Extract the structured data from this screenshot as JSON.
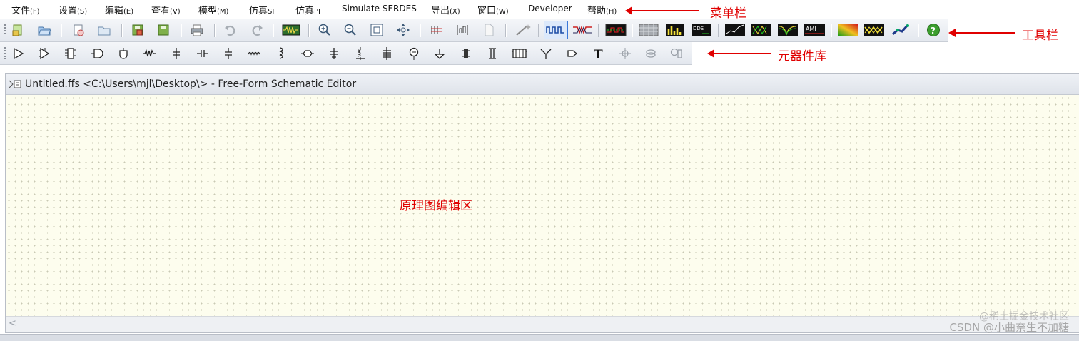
{
  "menubar": {
    "items": [
      {
        "label": "文件",
        "accel": "(F)"
      },
      {
        "label": "设置",
        "accel": "(S)"
      },
      {
        "label": "编辑",
        "accel": "(E)"
      },
      {
        "label": "查看",
        "accel": "(V)"
      },
      {
        "label": "模型",
        "accel": "(M)"
      },
      {
        "label": "仿真",
        "accel": "SI"
      },
      {
        "label": "仿真",
        "accel": "PI"
      },
      {
        "label": "Simulate SERDES",
        "accel": ""
      },
      {
        "label": "导出",
        "accel": "(X)"
      },
      {
        "label": "窗口",
        "accel": "(W)"
      },
      {
        "label": "Developer",
        "accel": ""
      },
      {
        "label": "帮助",
        "accel": "(H)"
      }
    ]
  },
  "annotations": {
    "menubar": "菜单栏",
    "toolbar": "工具栏",
    "library": "元器件库",
    "canvas": "原理图编辑区"
  },
  "toolbar": {
    "icons": [
      "new-schematic-icon",
      "open-icon",
      "new-from-template-icon",
      "open-folder-icon",
      "save-icon",
      "save-as-icon",
      "print-icon",
      "undo-icon",
      "redo-icon",
      "scope-waveform-icon",
      "zoom-in-icon",
      "zoom-out-icon",
      "zoom-fit-icon",
      "pan-icon",
      "bus-icon",
      "sweep-icon",
      "page-icon",
      "wand-icon",
      "waveform-icon",
      "crosstalk-icon",
      "eye-monitor-icon",
      "grid-icon",
      "bar-chart-icon",
      "dds-icon",
      "line-graph-icon",
      "spectrum-icon",
      "filter-icon",
      "ami-icon",
      "heatmap-icon",
      "stat-eye-icon",
      "network-icon",
      "help-icon"
    ],
    "help_color": "#3c9e2e",
    "accent": "#3b78d8"
  },
  "library": {
    "icons": [
      "buffer-icon",
      "driver-icon",
      "ibis-package-icon",
      "diff-buffer-icon",
      "receiver-icon",
      "resistor-icon",
      "rlc-icon",
      "capacitor-icon",
      "inductor-icon",
      "transmission-line-icon",
      "coupled-line-icon",
      "connector-icon",
      "ground-rlc-icon",
      "tlines-icon",
      "stacked-line-icon",
      "probe-icon",
      "ground-icon",
      "ferrite-icon",
      "via-icon",
      "package-model-icon",
      "splitter-icon",
      "terminator-icon",
      "text-icon",
      "node-icon",
      "link-icon",
      "measurement-icon"
    ]
  },
  "document": {
    "title": "Untitled.ffs <C:\\Users\\mjl\\Desktop\\> - Free-Form Schematic Editor"
  },
  "watermark": "CSDN @小曲奈生不加糖",
  "watermark2": "@稀土掘金技术社区"
}
